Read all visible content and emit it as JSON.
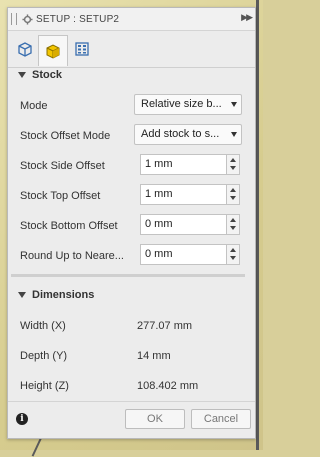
{
  "window": {
    "title": "SETUP : SETUP2"
  },
  "tabs": [
    {
      "name": "setup-tab-icon"
    },
    {
      "name": "stock-tab-icon",
      "active": true
    },
    {
      "name": "post-process-tab-icon"
    }
  ],
  "stock": {
    "header": "Stock",
    "rows": [
      {
        "label": "Mode",
        "value": "Relative size b..."
      },
      {
        "label": "Stock Offset Mode",
        "value": "Add stock to s..."
      },
      {
        "label": "Stock Side Offset",
        "value": "1 mm"
      },
      {
        "label": "Stock Top Offset",
        "value": "1 mm"
      },
      {
        "label": "Stock Bottom Offset",
        "value": "0 mm"
      },
      {
        "label": "Round Up to Neare...",
        "value": "0 mm"
      }
    ]
  },
  "dimensions": {
    "header": "Dimensions",
    "rows": [
      {
        "label": "Width (X)",
        "value": "277.07 mm"
      },
      {
        "label": "Depth (Y)",
        "value": "14 mm"
      },
      {
        "label": "Height (Z)",
        "value": "108.402 mm"
      }
    ]
  },
  "footer": {
    "info_glyph": "i",
    "ok_label": "OK",
    "cancel_label": "Cancel"
  },
  "colors": {
    "panel_bg": "#ececec",
    "active_tab_icon": "#f2c500",
    "tab_icon_blue": "#3a6fb0"
  }
}
